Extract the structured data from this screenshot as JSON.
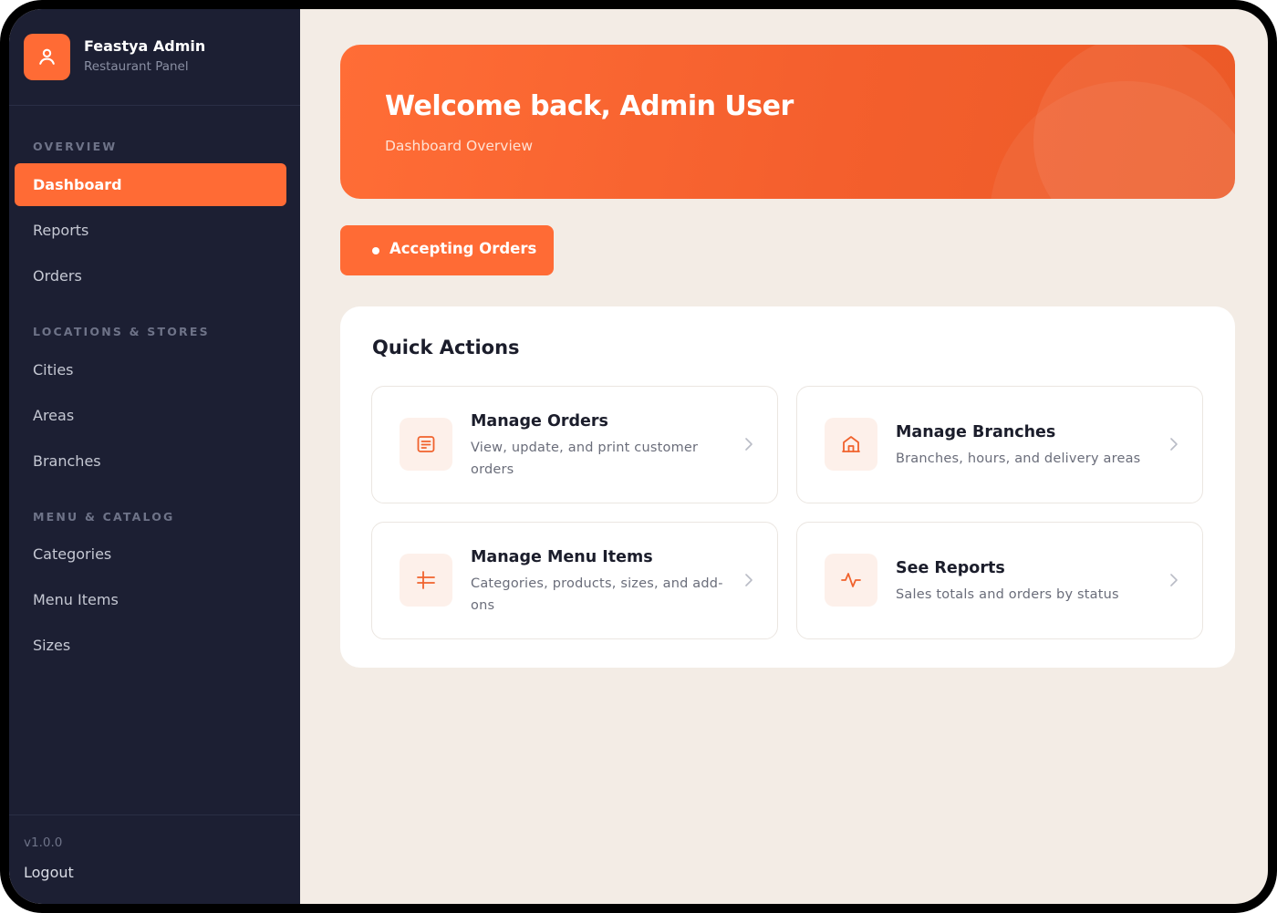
{
  "brand": {
    "title": "Feastya Admin",
    "subtitle": "Restaurant Panel"
  },
  "sidebar": {
    "sections": [
      {
        "label": "OVERVIEW"
      },
      {
        "label": "LOCATIONS & STORES"
      },
      {
        "label": "MENU & CATALOG"
      }
    ],
    "items": [
      {
        "label": "Dashboard",
        "active": true
      },
      {
        "label": "Reports"
      },
      {
        "label": "Orders"
      },
      {
        "label": "Cities"
      },
      {
        "label": "Areas"
      },
      {
        "label": "Branches"
      },
      {
        "label": "Categories"
      },
      {
        "label": "Menu Items"
      },
      {
        "label": "Sizes"
      }
    ],
    "version": "v1.0.0",
    "logout": "Logout"
  },
  "hero": {
    "title": "Welcome back, Admin User",
    "subtitle": "Dashboard Overview"
  },
  "status": {
    "label": "Accepting Orders"
  },
  "quick_actions": {
    "title": "Quick Actions",
    "items": [
      {
        "title": "Manage Orders",
        "desc": "View, update, and print customer orders",
        "icon": "receipt-icon"
      },
      {
        "title": "Manage Branches",
        "desc": "Branches, hours, and delivery areas",
        "icon": "store-icon"
      },
      {
        "title": "Manage Menu Items",
        "desc": "Categories, products, sizes, and add-ons",
        "icon": "menu-list-icon"
      },
      {
        "title": "See Reports",
        "desc": "Sales totals and orders by status",
        "icon": "activity-icon"
      }
    ]
  },
  "colors": {
    "accent": "#ff6b35",
    "sidebar_bg": "#1c1f33",
    "page_bg": "#f3ece5"
  }
}
